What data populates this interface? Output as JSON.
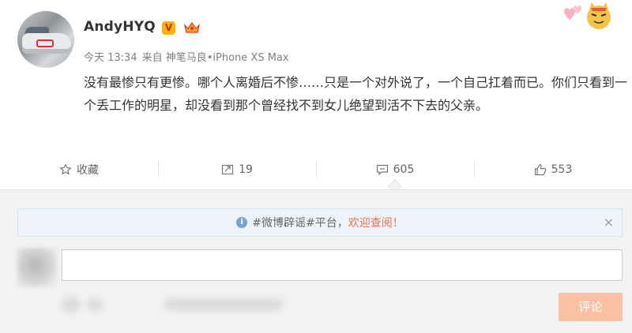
{
  "post": {
    "username": "AndyHYQ",
    "verified_badge": "V",
    "meta": {
      "time": "今天 13:34",
      "source": "来自 神笔马良•iPhone XS Max"
    },
    "text": "没有最惨只有更惨。哪个人离婚后不惨……只是一个对外说了，一个自己扛着而已。你们只看到一个丢工作的明星，却没看到那个曾经找不到女儿绝望到活不下去的父亲。"
  },
  "actions": {
    "favorite": {
      "label": "收藏",
      "icon": "star-icon"
    },
    "repost": {
      "count": "19",
      "icon": "repost-icon"
    },
    "comment": {
      "count": "605",
      "icon": "comment-icon"
    },
    "like": {
      "count": "553",
      "icon": "thumbs-up-icon"
    }
  },
  "comment_box": {
    "notice_prefix": "#微博辟谣#平台，",
    "notice_highlight": "欢迎查阅！",
    "notice_icon": "info-icon",
    "close_symbol": "×",
    "input_value": "",
    "submit_label": "评论"
  },
  "colors": {
    "text": "#333333",
    "meta": "#808080",
    "accent": "#eb7350",
    "submit_disabled": "#f8c1a3",
    "badge": "#f7b500",
    "notice_bg": "#edf3f9",
    "comment_area_bg": "#f2f2f5"
  }
}
